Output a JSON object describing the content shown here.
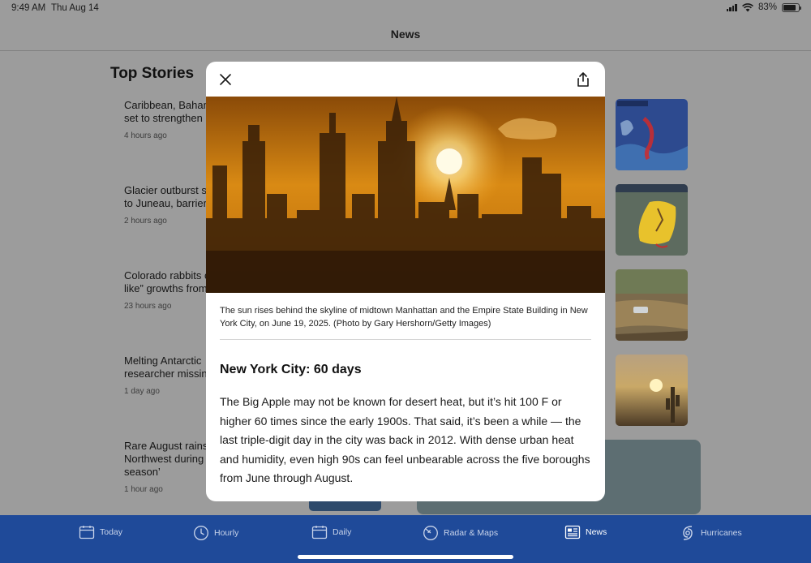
{
  "status_bar": {
    "time": "9:49 AM",
    "date": "Thu Aug 14",
    "battery": "83%",
    "battery_level": 0.83
  },
  "header": {
    "title": "News"
  },
  "list": {
    "section_title": "Top Stories",
    "stories": [
      {
        "headline": "Caribbean, Baham set to strengthen",
        "age": "4 hours ago"
      },
      {
        "headline": "Glacier outburst s to Juneau, barrier",
        "age": "2 hours ago"
      },
      {
        "headline": "Colorado rabbits c like” growths from",
        "age": "23 hours ago"
      },
      {
        "headline": "Melting Antarctic researcher missin",
        "age": "1 day ago"
      },
      {
        "headline": "Rare August rainst Northwest during season’",
        "age": "1 hour ago"
      }
    ]
  },
  "modal": {
    "caption": "The sun rises behind the skyline of midtown Manhattan and the Empire State Building in New York City, on June 19, 2025. (Photo by Gary Hershorn/Getty Images)",
    "heading": "New York City: 60 days",
    "body": "The Big Apple may not be known for desert heat, but it’s hit 100 F or higher 60 times since the early 1900s. That said, it’s been a while — the last triple-digit day in the city was back in 2012. With dense urban heat and humidity, even high 90s can feel unbearable across the five boroughs from June through August."
  },
  "tabs": [
    {
      "label": "Today",
      "icon": "calendar-icon"
    },
    {
      "label": "Hourly",
      "icon": "clock-icon"
    },
    {
      "label": "Daily",
      "icon": "calendar-icon"
    },
    {
      "label": "Radar & Maps",
      "icon": "radar-icon"
    },
    {
      "label": "News",
      "icon": "newspaper-icon"
    },
    {
      "label": "Hurricanes",
      "icon": "hurricane-icon"
    }
  ],
  "colors": {
    "tab_bar": "#1f4a99",
    "overlay": "#9c9c9c",
    "modal_bg": "#ffffff"
  }
}
